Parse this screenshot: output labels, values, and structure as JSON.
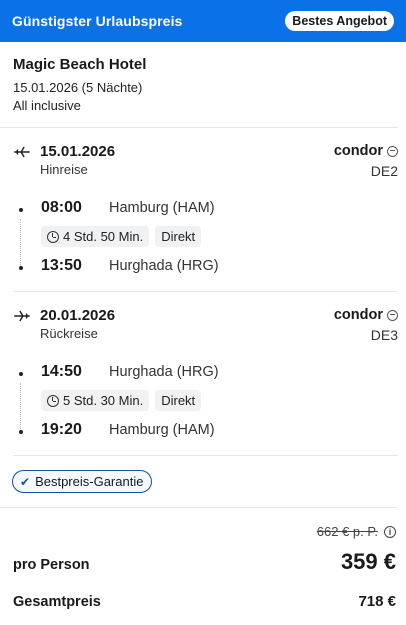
{
  "header": {
    "title": "Günstigster Urlaubspreis",
    "badge": "Bestes Angebot"
  },
  "hotel": {
    "name": "Magic Beach Hotel",
    "dates": "15.01.2026 (5 Nächte)",
    "board": "All inclusive"
  },
  "outbound": {
    "date": "15.01.2026",
    "label": "Hinreise",
    "airline": "condor",
    "flight": "DE2",
    "dep_time": "08:00",
    "dep_place": "Hamburg (HAM)",
    "duration": "4 Std. 50 Min.",
    "type": "Direkt",
    "arr_time": "13:50",
    "arr_place": "Hurghada (HRG)"
  },
  "return": {
    "date": "20.01.2026",
    "label": "Rückreise",
    "airline": "condor",
    "flight": "DE3",
    "dep_time": "14:50",
    "dep_place": "Hurghada (HRG)",
    "duration": "5 Std. 30 Min.",
    "type": "Direkt",
    "arr_time": "19:20",
    "arr_place": "Hamburg (HAM)"
  },
  "badge_guarantee": "Bestpreis-Garantie",
  "prices": {
    "old": "662 € p. P.",
    "per_person_label": "pro Person",
    "per_person": "359 €",
    "total_label": "Gesamtpreis",
    "total": "718 €"
  }
}
